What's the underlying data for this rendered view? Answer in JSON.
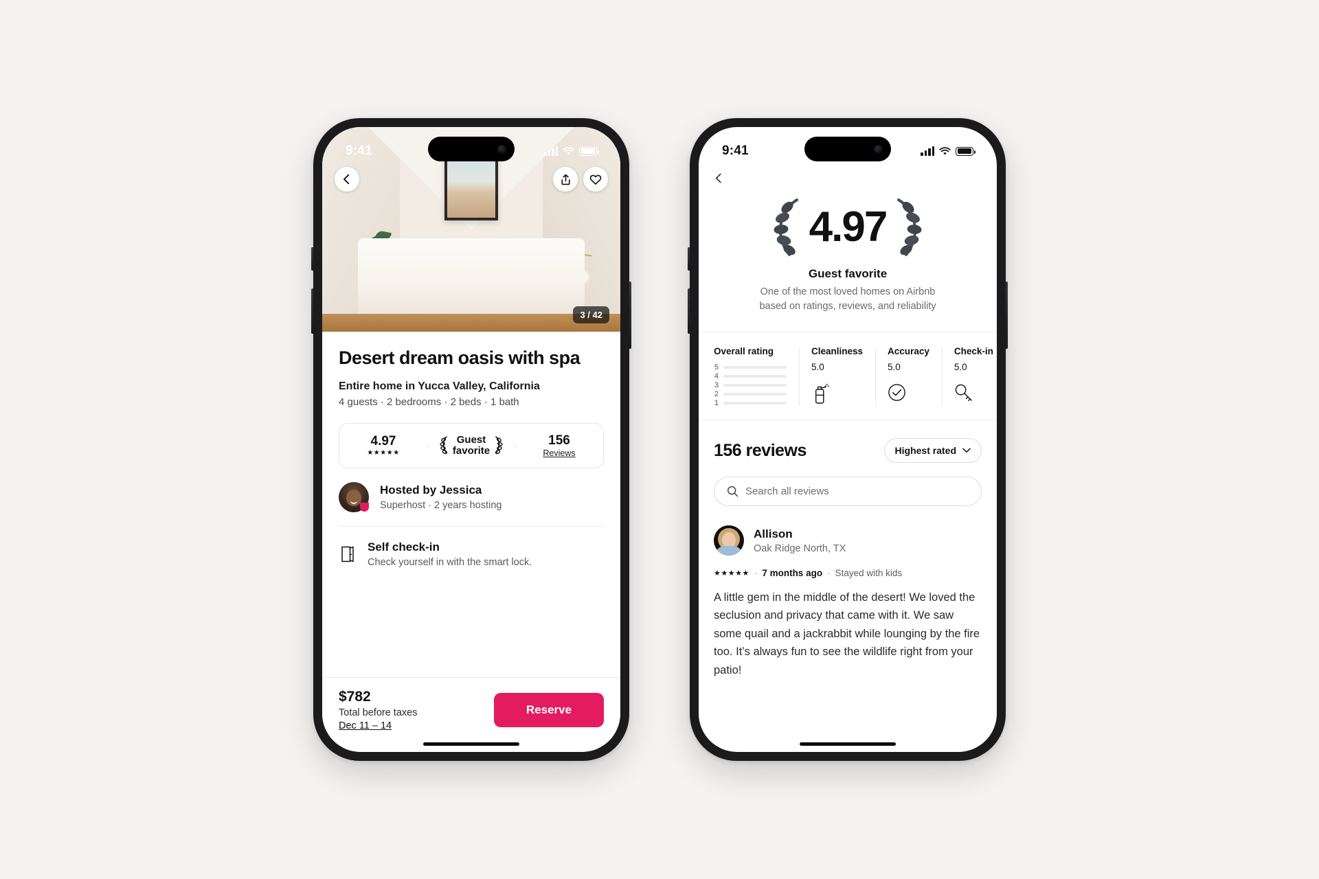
{
  "left_phone": {
    "status_bar": {
      "time": "9:41",
      "signal_icon": "cellular-signal-icon",
      "wifi_icon": "wifi-icon",
      "battery_icon": "battery-icon"
    },
    "hero": {
      "back_icon": "chevron-left-icon",
      "share_icon": "share-icon",
      "save_icon": "heart-icon",
      "photo_counter": "3 / 42"
    },
    "listing": {
      "title": "Desert dream oasis with spa",
      "subtitle": "Entire home in Yucca Valley, California",
      "specs": "4 guests · 2 bedrooms · 2 beds · 1 bath"
    },
    "rating_card": {
      "score": "4.97",
      "stars": "★★★★★",
      "guest_favorite_line1": "Guest",
      "guest_favorite_line2": "favorite",
      "laurel_icon": "laurel-wreath-icon",
      "review_count": "156",
      "review_label": "Reviews"
    },
    "host": {
      "avatar_icon": "host-avatar",
      "superhost_badge_icon": "superhost-badge-icon",
      "name": "Hosted by Jessica",
      "meta": "Superhost · 2 years hosting"
    },
    "checkin": {
      "icon": "door-icon",
      "title": "Self check-in",
      "description": "Check yourself in with the smart lock."
    },
    "booking": {
      "price": "$782",
      "price_note": "Total before taxes",
      "dates": "Dec 11 – 14",
      "reserve_label": "Reserve",
      "reserve_color": "#e31c5f"
    }
  },
  "right_phone": {
    "status_bar": {
      "time": "9:41",
      "signal_icon": "cellular-signal-icon",
      "wifi_icon": "wifi-icon",
      "battery_icon": "battery-icon"
    },
    "back_icon": "chevron-left-icon",
    "hero": {
      "score": "4.97",
      "laurel_left_icon": "laurel-left-icon",
      "laurel_right_icon": "laurel-right-icon",
      "title": "Guest favorite",
      "desc_line1": "One of the most loved homes on Airbnb",
      "desc_line2": "based on ratings, reviews, and reliability"
    },
    "breakdown": {
      "overall_label": "Overall rating",
      "bars": [
        {
          "label": "5",
          "pct": 97
        },
        {
          "label": "4",
          "pct": 3
        },
        {
          "label": "3",
          "pct": 0
        },
        {
          "label": "2",
          "pct": 0
        },
        {
          "label": "1",
          "pct": 0
        }
      ],
      "categories": [
        {
          "label": "Cleanliness",
          "value": "5.0",
          "icon": "spray-bottle-icon"
        },
        {
          "label": "Accuracy",
          "value": "5.0",
          "icon": "check-circle-icon"
        },
        {
          "label": "Check-in",
          "value": "5.0",
          "icon": "key-icon"
        }
      ]
    },
    "reviews": {
      "count_label": "156 reviews",
      "sort_label": "Highest rated",
      "sort_chevron_icon": "chevron-down-icon",
      "search_icon": "search-icon",
      "search_placeholder": "Search all reviews",
      "search_value": "",
      "items": [
        {
          "avatar_icon": "reviewer-avatar",
          "name": "Allison",
          "location": "Oak Ridge North, TX",
          "stars": "★★★★★",
          "time": "7 months ago",
          "trip_type": "Stayed with kids",
          "text": "A little gem in the middle of the desert! We loved the seclusion and privacy that came with it. We saw some quail and a jackrabbit while lounging by the fire too. It’s always fun to see the wildlife right from your patio!"
        }
      ]
    }
  },
  "chart_data": {
    "type": "bar",
    "title": "Overall rating",
    "categories": [
      "5",
      "4",
      "3",
      "2",
      "1"
    ],
    "values": [
      97,
      3,
      0,
      0,
      0
    ],
    "xlabel": "",
    "ylabel": "",
    "ylim": [
      0,
      100
    ],
    "orientation": "horizontal",
    "grid": false,
    "legend": "none"
  }
}
